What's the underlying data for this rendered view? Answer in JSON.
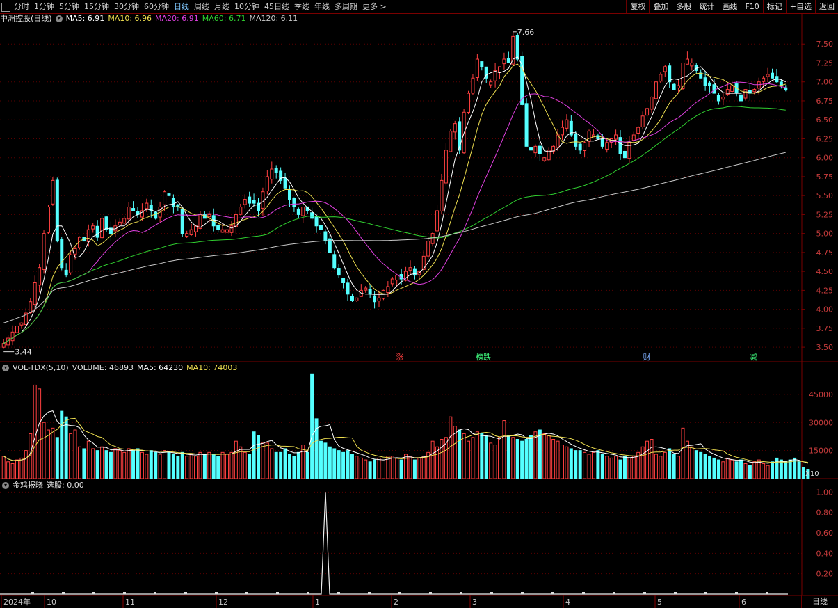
{
  "toolbar": {
    "periods": [
      "分时",
      "1分钟",
      "5分钟",
      "15分钟",
      "30分钟",
      "60分钟",
      "日线",
      "周线",
      "月线",
      "10分钟",
      "45日线",
      "季线",
      "年线",
      "多周期",
      "更多 >"
    ],
    "active_period": "日线",
    "buttons": [
      "复权",
      "叠加",
      "多股",
      "统计",
      "画线",
      "F10",
      "标记",
      "+自选",
      "返回"
    ]
  },
  "main_panel": {
    "title": "中洲控股(日线)",
    "indicators": [
      {
        "label": "MA5: 6.91",
        "color": "#ffffff"
      },
      {
        "label": "MA10: 6.96",
        "color": "#f0e050"
      },
      {
        "label": "MA20: 6.91",
        "color": "#e040e0"
      },
      {
        "label": "MA60: 6.71",
        "color": "#30d030"
      },
      {
        "label": "MA120: 6.11",
        "color": "#c8c8c8"
      }
    ],
    "high_label": "7.66",
    "low_label": "3.44",
    "markers": [
      {
        "text": "涨",
        "color": "#ff4040"
      },
      {
        "text": "榜跌",
        "color": "#40ff80"
      },
      {
        "text": "财",
        "color": "#80b0ff"
      },
      {
        "text": "减",
        "color": "#40ff80"
      }
    ]
  },
  "vol_panel": {
    "title": "VOL-TDX(5,10)",
    "volume": "VOLUME: 46893",
    "ma5": "MA5: 64230",
    "ma10": "MA10: 74003",
    "unit": "X10"
  },
  "sub_panel": {
    "title": "金鸡报晓",
    "value": "选股: 0.00"
  },
  "xaxis": {
    "labels": [
      "2024年",
      "10",
      "11",
      "12",
      "1",
      "2",
      "3",
      "4",
      "5",
      "6"
    ]
  },
  "bottom_right_label": "日线",
  "chart_data": [
    {
      "type": "candlestick",
      "title": "中洲控股(日线)",
      "ylim": [
        3.4,
        7.75
      ],
      "yticks": [
        3.5,
        3.75,
        4.0,
        4.25,
        4.5,
        4.75,
        5.0,
        5.25,
        5.5,
        5.75,
        6.0,
        6.25,
        6.5,
        6.75,
        7.0,
        7.25,
        7.5
      ],
      "close": [
        3.55,
        3.62,
        3.7,
        3.78,
        3.82,
        3.95,
        4.1,
        4.35,
        4.55,
        5.0,
        5.35,
        5.7,
        4.9,
        4.55,
        4.45,
        4.72,
        4.8,
        4.95,
        4.9,
        5.05,
        5.1,
        4.95,
        5.2,
        5.05,
        5.0,
        5.1,
        5.15,
        5.2,
        5.35,
        5.3,
        5.25,
        5.3,
        5.4,
        5.3,
        5.2,
        5.35,
        5.55,
        5.5,
        5.35,
        5.35,
        5.0,
        5.0,
        5.05,
        5.1,
        5.25,
        5.2,
        5.25,
        5.1,
        5.05,
        5.05,
        5.05,
        5.1,
        5.25,
        5.35,
        5.45,
        5.4,
        5.4,
        5.3,
        5.55,
        5.75,
        5.85,
        5.8,
        5.7,
        5.6,
        5.45,
        5.35,
        5.25,
        5.35,
        5.3,
        5.2,
        5.1,
        5.05,
        4.9,
        4.75,
        4.55,
        4.45,
        4.35,
        4.2,
        4.12,
        4.15,
        4.25,
        4.28,
        4.2,
        4.1,
        4.15,
        4.25,
        4.3,
        4.4,
        4.45,
        4.4,
        4.5,
        4.55,
        4.45,
        4.5,
        4.7,
        4.9,
        5.0,
        5.3,
        5.7,
        6.1,
        6.35,
        6.45,
        6.1,
        6.6,
        6.85,
        7.05,
        7.3,
        7.2,
        7.05,
        7.0,
        7.15,
        7.2,
        7.3,
        7.25,
        7.6,
        7.3,
        6.7,
        6.15,
        6.1,
        6.15,
        6.05,
        6.0,
        6.1,
        6.15,
        6.3,
        6.4,
        6.5,
        6.3,
        6.15,
        6.1,
        6.2,
        6.35,
        6.3,
        6.25,
        6.15,
        6.2,
        6.25,
        6.3,
        6.05,
        6.0,
        6.2,
        6.3,
        6.4,
        6.55,
        6.65,
        6.8,
        7.0,
        7.1,
        7.2,
        7.0,
        6.9,
        6.95,
        7.25,
        7.3,
        7.25,
        7.15,
        7.05,
        6.95,
        6.95,
        6.85,
        6.75,
        6.8,
        6.9,
        6.95,
        6.85,
        6.75,
        6.9,
        6.85,
        6.9,
        7.0,
        7.05,
        7.1,
        7.05,
        7.0,
        6.95,
        6.9
      ],
      "ma_series": [
        {
          "name": "MA5",
          "color": "#ffffff",
          "last": 6.91
        },
        {
          "name": "MA10",
          "color": "#f0e050",
          "last": 6.96
        },
        {
          "name": "MA20",
          "color": "#e040e0",
          "last": 6.91
        },
        {
          "name": "MA60",
          "color": "#30d030",
          "last": 6.71
        },
        {
          "name": "MA120",
          "color": "#c8c8c8",
          "last": 6.11
        }
      ],
      "high": 7.66,
      "low": 3.44
    },
    {
      "type": "bar",
      "title": "VOL-TDX(5,10)",
      "ylim": [
        0,
        55000
      ],
      "yticks": [
        15000,
        30000,
        45000
      ],
      "values": [
        12000,
        9000,
        8000,
        10000,
        11000,
        15000,
        24000,
        50000,
        48000,
        30000,
        26000,
        27000,
        22000,
        36000,
        33000,
        24000,
        26000,
        17000,
        16000,
        20000,
        16000,
        15000,
        17000,
        15000,
        14000,
        16000,
        15000,
        14000,
        16000,
        15000,
        16000,
        14000,
        13000,
        15000,
        14000,
        13000,
        15000,
        14000,
        13000,
        12000,
        14000,
        12000,
        13000,
        12000,
        14000,
        13000,
        14000,
        13000,
        12000,
        14000,
        13000,
        14000,
        20000,
        17000,
        14000,
        13000,
        25000,
        23000,
        19000,
        19000,
        16000,
        14000,
        14000,
        16000,
        13000,
        12000,
        14000,
        18000,
        14000,
        56000,
        32000,
        20000,
        19000,
        17000,
        16000,
        15000,
        14000,
        15000,
        13000,
        12000,
        11000,
        10000,
        9000,
        10000,
        11000,
        10000,
        12000,
        12000,
        11000,
        10000,
        13000,
        12000,
        10000,
        11000,
        12000,
        14000,
        20000,
        17000,
        21000,
        22000,
        33000,
        28000,
        26000,
        24000,
        20000,
        22000,
        25000,
        24000,
        23000,
        19000,
        18000,
        22000,
        31000,
        23000,
        22000,
        21000,
        20000,
        21000,
        23000,
        25000,
        26000,
        24000,
        23000,
        21000,
        20000,
        18000,
        17000,
        16000,
        15000,
        15000,
        14000,
        13000,
        14000,
        15000,
        13000,
        12000,
        11000,
        12000,
        10000,
        12000,
        11000,
        12000,
        14000,
        17000,
        20000,
        21000,
        13000,
        12000,
        14000,
        16000,
        13000,
        12000,
        27000,
        20000,
        17000,
        15000,
        14000,
        13000,
        12000,
        11000,
        10000,
        9000,
        11000,
        10000,
        9000,
        10000,
        8000,
        7000,
        9000,
        10000,
        8000,
        7000,
        9000,
        11000,
        10000,
        9000,
        10000,
        11000,
        9000,
        6000,
        5000
      ],
      "ma_series": [
        {
          "name": "MA5",
          "color": "#ffffff",
          "last": 64230
        },
        {
          "name": "MA10",
          "color": "#f0e050",
          "last": 74003
        }
      ]
    },
    {
      "type": "line",
      "title": "金鸡报晓",
      "ylim": [
        0,
        1.05
      ],
      "yticks": [
        0.2,
        0.4,
        0.6,
        0.8,
        1.0
      ],
      "spike_value": 1.0,
      "last": 0.0
    }
  ]
}
